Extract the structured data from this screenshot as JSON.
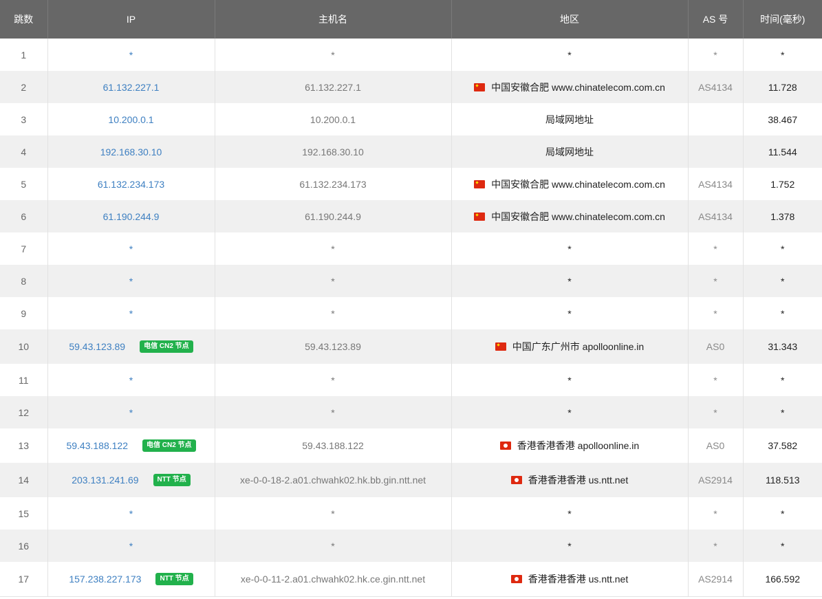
{
  "headers": {
    "hop": "跳数",
    "ip": "IP",
    "host": "主机名",
    "region": "地区",
    "as": "AS 号",
    "time": "时间(毫秒)"
  },
  "rows": [
    {
      "hop": "1",
      "ip": "*",
      "host": "*",
      "region": "*",
      "flag": "",
      "as": "*",
      "time": "*",
      "badge": ""
    },
    {
      "hop": "2",
      "ip": "61.132.227.1",
      "host": "61.132.227.1",
      "region": "中国安徽合肥 www.chinatelecom.com.cn",
      "flag": "cn-flag-icon",
      "as": "AS4134",
      "time": "11.728",
      "badge": ""
    },
    {
      "hop": "3",
      "ip": "10.200.0.1",
      "host": "10.200.0.1",
      "region": "局域网地址",
      "flag": "",
      "as": "",
      "time": "38.467",
      "badge": ""
    },
    {
      "hop": "4",
      "ip": "192.168.30.10",
      "host": "192.168.30.10",
      "region": "局域网地址",
      "flag": "",
      "as": "",
      "time": "11.544",
      "badge": ""
    },
    {
      "hop": "5",
      "ip": "61.132.234.173",
      "host": "61.132.234.173",
      "region": "中国安徽合肥 www.chinatelecom.com.cn",
      "flag": "cn-flag-icon",
      "as": "AS4134",
      "time": "1.752",
      "badge": ""
    },
    {
      "hop": "6",
      "ip": "61.190.244.9",
      "host": "61.190.244.9",
      "region": "中国安徽合肥 www.chinatelecom.com.cn",
      "flag": "cn-flag-icon",
      "as": "AS4134",
      "time": "1.378",
      "badge": ""
    },
    {
      "hop": "7",
      "ip": "*",
      "host": "*",
      "region": "*",
      "flag": "",
      "as": "*",
      "time": "*",
      "badge": ""
    },
    {
      "hop": "8",
      "ip": "*",
      "host": "*",
      "region": "*",
      "flag": "",
      "as": "*",
      "time": "*",
      "badge": ""
    },
    {
      "hop": "9",
      "ip": "*",
      "host": "*",
      "region": "*",
      "flag": "",
      "as": "*",
      "time": "*",
      "badge": ""
    },
    {
      "hop": "10",
      "ip": "59.43.123.89",
      "host": "59.43.123.89",
      "region": "中国广东广州市 apolloonline.in",
      "flag": "cn-flag-icon",
      "as": "AS0",
      "time": "31.343",
      "badge": "电信 CN2 节点"
    },
    {
      "hop": "11",
      "ip": "*",
      "host": "*",
      "region": "*",
      "flag": "",
      "as": "*",
      "time": "*",
      "badge": ""
    },
    {
      "hop": "12",
      "ip": "*",
      "host": "*",
      "region": "*",
      "flag": "",
      "as": "*",
      "time": "*",
      "badge": ""
    },
    {
      "hop": "13",
      "ip": "59.43.188.122",
      "host": "59.43.188.122",
      "region": "香港香港香港 apolloonline.in",
      "flag": "hk-flag-icon",
      "as": "AS0",
      "time": "37.582",
      "badge": "电信 CN2 节点"
    },
    {
      "hop": "14",
      "ip": "203.131.241.69",
      "host": "xe-0-0-18-2.a01.chwahk02.hk.bb.gin.ntt.net",
      "region": "香港香港香港 us.ntt.net",
      "flag": "hk-flag-icon",
      "as": "AS2914",
      "time": "118.513",
      "badge": "NTT 节点"
    },
    {
      "hop": "15",
      "ip": "*",
      "host": "*",
      "region": "*",
      "flag": "",
      "as": "*",
      "time": "*",
      "badge": ""
    },
    {
      "hop": "16",
      "ip": "*",
      "host": "*",
      "region": "*",
      "flag": "",
      "as": "*",
      "time": "*",
      "badge": ""
    },
    {
      "hop": "17",
      "ip": "157.238.227.173",
      "host": "xe-0-0-11-2.a01.chwahk02.hk.ce.gin.ntt.net",
      "region": "香港香港香港 us.ntt.net",
      "flag": "hk-flag-icon",
      "as": "AS2914",
      "time": "166.592",
      "badge": "NTT 节点"
    }
  ]
}
